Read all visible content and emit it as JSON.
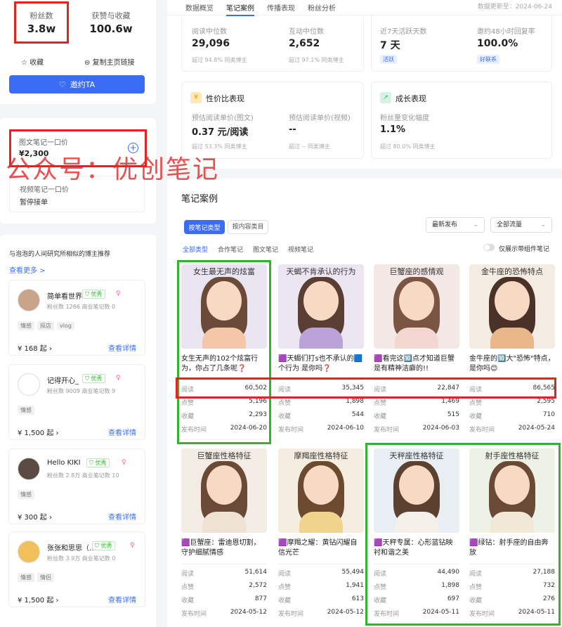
{
  "profile": {
    "fans_label": "粉丝数",
    "fans_value": "3.8w",
    "likes_label": "获赞与收藏",
    "likes_value": "100.6w",
    "collect_label": "收藏",
    "copy_label": "复制主页链接",
    "invite_label": "邀约TA"
  },
  "price": {
    "image_label": "图文笔记一口价",
    "image_value": "¥2,300",
    "video_label": "视频笔记一口价",
    "video_value": "暂停接单"
  },
  "watermark": "公众号：优创笔记",
  "similar": {
    "title": "与泡泡的人间研究所相似的博主推荐",
    "more": "查看更多 >",
    "detail": "查看详情",
    "items": [
      {
        "name": "简单看世界",
        "badge": "优秀",
        "meta": "粉丝数 1266  商业笔记数 0",
        "tags": [
          "情感",
          "探店",
          "vlog"
        ],
        "price": "¥ 168 起"
      },
      {
        "name": "记得开心_",
        "badge": "优秀",
        "meta": "粉丝数 9009  商业笔记数 9",
        "tags": [
          "情感"
        ],
        "price": "¥ 1,500 起"
      },
      {
        "name": "Hello KIKI",
        "badge": "优秀",
        "meta": "粉丝数 2.8万  商业笔记数 10",
        "tags": [
          "情感"
        ],
        "price": "¥ 300 起"
      },
      {
        "name": "张张和思思（...",
        "badge": "优秀",
        "meta": "粉丝数 3.9万  商业笔记数 0",
        "tags": [
          "情感",
          "情侣"
        ],
        "price": "¥ 1,500 起"
      }
    ]
  },
  "tabs": [
    "数据概览",
    "笔记案例",
    "传播表现",
    "粉丝分析"
  ],
  "update": "数据更新至：2024-06-24",
  "stats": {
    "read_label": "阅读中位数",
    "read_value": "29,096",
    "read_sub": "超过 94.8% 同类博主",
    "inter_label": "互动中位数",
    "inter_value": "2,652",
    "inter_sub": "超过 97.1% 同类博主",
    "active_label": "近7天活跃天数",
    "active_value": "7 天",
    "active_tag": "活跃",
    "reply_label": "邀约48小时回复率",
    "reply_value": "100.0%",
    "reply_tag": "好联系"
  },
  "cost": {
    "title": "性价比表现",
    "img_label": "预估阅读单价(图文)",
    "img_value": "0.37 元/阅读",
    "img_sub": "超过 53.3% 同类博主",
    "vid_label": "预估阅读单价(视频)",
    "vid_value": "--",
    "vid_sub": "超过 -- 同类博主"
  },
  "growth": {
    "title": "成长表现",
    "label": "粉丝量变化幅度",
    "value": "1.1%",
    "sub": "超过 80.0% 同类博主"
  },
  "notes_section": {
    "title": "笔记案例",
    "type_tab": "按笔记类型",
    "content_tab": "按内容类目",
    "sort": "最新发布",
    "traffic": "全部流量",
    "filters": [
      "全部类型",
      "合作笔记",
      "图文笔记",
      "视频笔记"
    ],
    "toggle": "仅展示带组件笔记",
    "labels": {
      "read": "阅读",
      "like": "点赞",
      "fav": "收藏",
      "time": "发布时间"
    }
  },
  "notes": [
    {
      "thumb": "女生最无声的炫富",
      "title": "女生无声的102个炫富行为，你占了几条呢❓",
      "read": "60,502",
      "like": "5,196",
      "fav": "2,293",
      "time": "2024-06-20",
      "tint": "#e8e4f0",
      "hair": "#6b4a3a",
      "cloth": "#f4c7a8"
    },
    {
      "thumb": "天蝎不肯承认的行为",
      "title": "🟪天蝎们打s也不承认的🟦个行为 是你吗❓",
      "read": "35,345",
      "like": "1,898",
      "fav": "544",
      "time": "2024-06-10",
      "tint": "#ece6f2",
      "hair": "#5a3e34",
      "cloth": "#b9a3d8"
    },
    {
      "thumb": "巨蟹座的感情观",
      "title": "🟪看完这🔟点才知道巨蟹是有精神洁癖的!!",
      "read": "22,847",
      "like": "1,469",
      "fav": "515",
      "time": "2024-06-03",
      "tint": "#f3e8e6",
      "hair": "#7a5544",
      "cloth": "#f2d6cf"
    },
    {
      "thumb": "金牛座的恐怖特点",
      "title": "金牛座的🔟大\"恐怖\"特点，是你吗😊",
      "read": "86,565",
      "like": "2,595",
      "fav": "710",
      "time": "2024-05-24",
      "tint": "#f4ece2",
      "hair": "#4a3228",
      "cloth": "#e8b78a"
    },
    {
      "thumb": "巨蟹座性格特征",
      "title": "🟪巨蟹座：雷迪恩切割，守护细腻情感",
      "read": "51,614",
      "like": "2,572",
      "fav": "877",
      "time": "2024-05-12",
      "tint": "#f3ece4",
      "hair": "#6a4a36",
      "cloth": "#efe2d2"
    },
    {
      "thumb": "摩羯座性格特征",
      "title": "🟪摩羯之耀：黄钻闪耀自信光芒",
      "read": "55,494",
      "like": "1,941",
      "fav": "613",
      "time": "2024-05-12",
      "tint": "#f5eee0",
      "hair": "#6b4a30",
      "cloth": "#f0d48e"
    },
    {
      "thumb": "天秤座性格特征",
      "title": "🟪天秤专属：心形蓝钻映衬和谐之美",
      "read": "44,490",
      "like": "1,898",
      "fav": "697",
      "time": "2024-05-11",
      "tint": "#e8eef4",
      "hair": "#5c4030",
      "cloth": "#f4efe8"
    },
    {
      "thumb": "射手座性格特征",
      "title": "🟪绿钻：射手座的自由奔放",
      "read": "27,188",
      "like": "732",
      "fav": "276",
      "time": "2024-05-11",
      "tint": "#eef2e6",
      "hair": "#6a4a36",
      "cloth": "#f2e8d6"
    }
  ]
}
